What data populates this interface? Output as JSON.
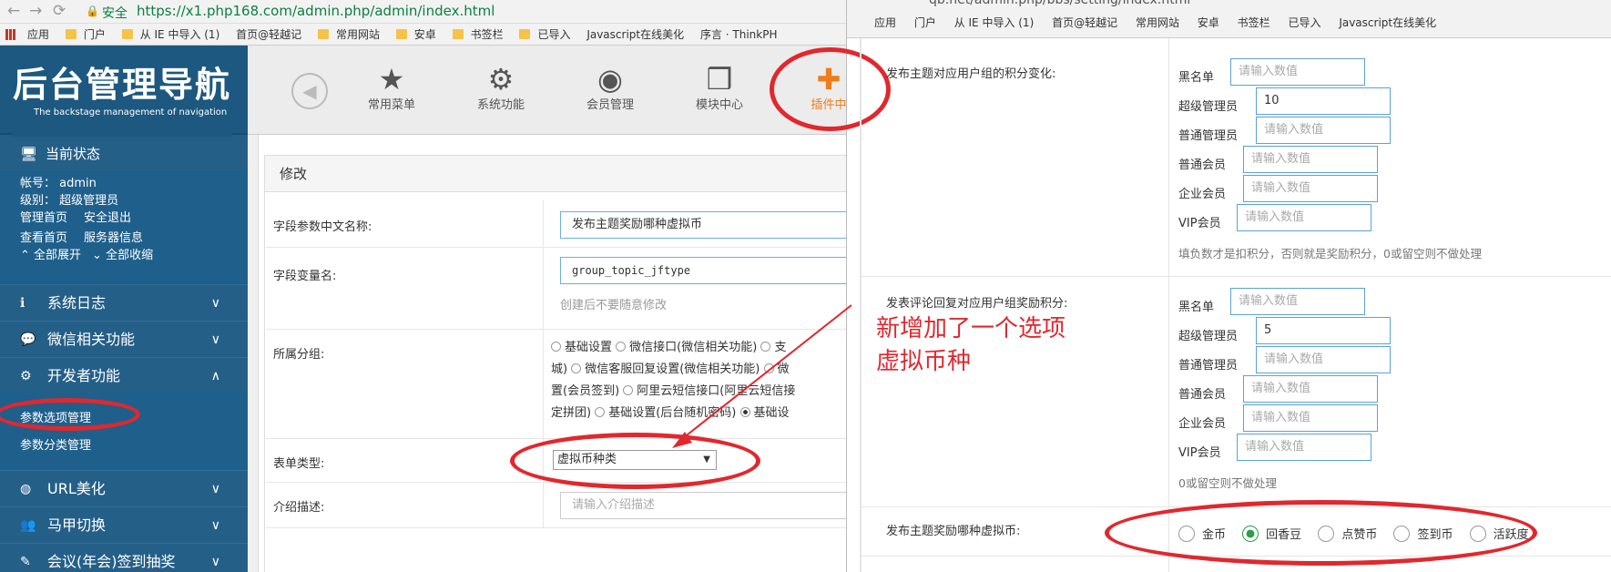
{
  "left": {
    "browser": {
      "secure": "安全",
      "url": "https://x1.php168.com/admin.php/admin/index.html",
      "bookmarks": [
        "应用",
        "门户",
        "从 IE 中导入 (1)",
        "首页@轻越记",
        "常用网站",
        "安卓",
        "书签栏",
        "已导入",
        "Javascript在线美化",
        "序言 · ThinkPH"
      ]
    },
    "logo": {
      "title": "后台管理导航",
      "subtitle": "The backstage management of navigation"
    },
    "sidebar": {
      "status": "当前状态",
      "account_label": "帐号：",
      "account": "admin",
      "level_label": "级别：",
      "level": "超级管理员",
      "links": [
        "管理首页",
        "安全退出",
        "查看首页",
        "服务器信息"
      ],
      "expand_all": "全部展开",
      "collapse_all": "全部收缩",
      "menu": [
        "系统日志",
        "微信相关功能",
        "开发者功能",
        "URL美化",
        "马甲切换",
        "会议(年会)签到抽奖"
      ],
      "dev_sub": [
        "参数选项管理",
        "参数分类管理"
      ]
    },
    "topnav": [
      "常用菜单",
      "系统功能",
      "会员管理",
      "模块中心",
      "插件中"
    ],
    "panel": {
      "title": "修改",
      "fields": {
        "cn_name_label": "字段参数中文名称:",
        "cn_name_value": "发布主题奖励哪种虚拟币",
        "var_label": "字段变量名:",
        "var_value": "group_topic_jftype",
        "var_hint": "创建后不要随意修改",
        "group_label": "所属分组:",
        "group_lines": [
          [
            "基础设置",
            "微信接口(微信相关功能)",
            "支"
          ],
          [
            "城)",
            "微信客服回复设置(微信相关功能)",
            "微"
          ],
          [
            "置(会员签到)",
            "阿里云短信接口(阿里云短信接"
          ],
          [
            "定拼团)",
            "基础设置(后台随机密码)",
            "基础设"
          ]
        ],
        "type_label": "表单类型:",
        "type_value": "虚拟币种类",
        "desc_label": "介绍描述:",
        "desc_placeholder": "请输入介绍描述"
      }
    }
  },
  "right": {
    "browser": {
      "url": "qb.net/admin.php/bbs/setting/index.html",
      "bookmarks": [
        "应用",
        "门户",
        "从 IE 中导入 (1)",
        "首页@轻越记",
        "常用网站",
        "安卓",
        "书签栏",
        "已导入",
        "Javascript在线美化"
      ]
    },
    "section1": {
      "title": "发布主题对应用户组的积分变化:",
      "labels": [
        "黑名单",
        "超级管理员",
        "普通管理员",
        "普通会员",
        "企业会员",
        "VIP会员"
      ],
      "values": [
        "",
        "10",
        "",
        "",
        "",
        ""
      ],
      "placeholder": "请输入数值",
      "hint": "填负数才是扣积分，否则就是奖励积分，0或留空则不做处理"
    },
    "section2": {
      "title": "发表评论回复对应用户组奖励积分:",
      "labels": [
        "黑名单",
        "超级管理员",
        "普通管理员",
        "普通会员",
        "企业会员",
        "VIP会员"
      ],
      "values": [
        "",
        "5",
        "",
        "",
        "",
        ""
      ],
      "placeholder": "请输入数值",
      "hint": "0或留空则不做处理"
    },
    "section3": {
      "title": "发布主题奖励哪种虚拟币:",
      "options": [
        "金币",
        "回香豆",
        "点赞币",
        "签到币",
        "活跃度"
      ],
      "selected": 1
    },
    "annotation": {
      "line1": "新增加了一个选项",
      "line2": "虚拟币种"
    }
  }
}
